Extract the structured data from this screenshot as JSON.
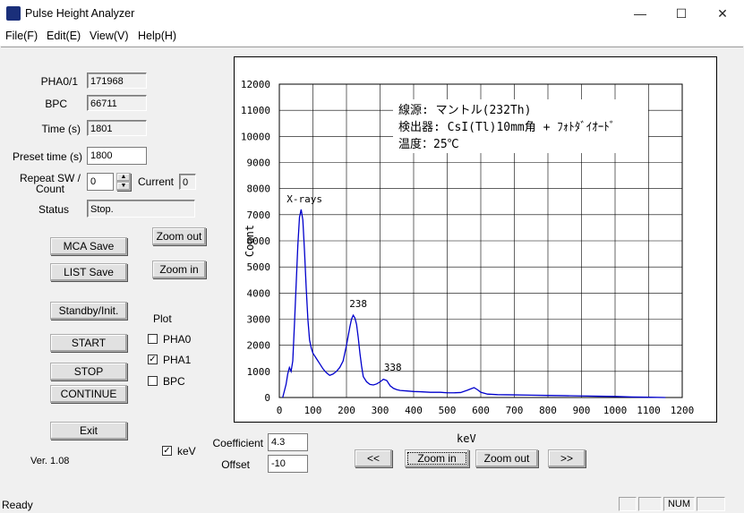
{
  "window": {
    "title": "Pulse Height Analyzer",
    "minimize": "—",
    "maximize": "☐",
    "close": "✕"
  },
  "menu": [
    "File(F)",
    "Edit(E)",
    "View(V)",
    "Help(H)"
  ],
  "fields": {
    "pha01_label": "PHA0/1",
    "pha01_value": "171968",
    "bpc_label": "BPC",
    "bpc_value": "66711",
    "time_label": "Time (s)",
    "time_value": "1801",
    "preset_label": "Preset time (s)",
    "preset_value": "1800",
    "repeat_label": "Repeat SW / Count",
    "repeat_value": "0",
    "current_label": "Current",
    "current_value": "0",
    "status_label": "Status",
    "status_value": "Stop."
  },
  "buttons": {
    "mca_save": "MCA Save",
    "list_save": "LIST Save",
    "standby": "Standby/Init.",
    "start": "START",
    "stop": "STOP",
    "continue": "CONTINUE",
    "exit": "Exit",
    "zoom_out_top": "Zoom out",
    "zoom_in_top": "Zoom in",
    "prev": "<<",
    "zoom_in_bottom": "Zoom in",
    "zoom_out_bottom": "Zoom out",
    "next": ">>"
  },
  "plot_options": {
    "heading": "Plot",
    "pha0": "PHA0",
    "pha0_checked": false,
    "pha1": "PHA1",
    "pha1_checked": true,
    "bpc": "BPC",
    "bpc_checked": false
  },
  "kev": {
    "label": "keV",
    "checked": true,
    "check_mark": "✓"
  },
  "calibration": {
    "coefficient_label": "Coefficient",
    "coefficient_value": "4.3",
    "offset_label": "Offset",
    "offset_value": "-10"
  },
  "version": "Ver. 1.08",
  "statusbar": {
    "text": "Ready",
    "num": "NUM"
  },
  "chart_data": {
    "type": "line",
    "xlabel": "keV",
    "ylabel": "Count",
    "xlim": [
      0,
      1200
    ],
    "ylim": [
      0,
      12000
    ],
    "xticks": [
      0,
      100,
      200,
      300,
      400,
      500,
      600,
      700,
      800,
      900,
      1000,
      1100,
      1200
    ],
    "yticks": [
      0,
      1000,
      2000,
      3000,
      4000,
      5000,
      6000,
      7000,
      8000,
      9000,
      10000,
      11000,
      12000
    ],
    "grid": true,
    "series_color": "#0000cc",
    "annotation_lines": [
      "線源: マントル(232Th)",
      "検出器: CsI(Tl)10mm角 + ﾌｫﾄﾀﾞｲｵｰﾄﾞ",
      "温度：25℃"
    ],
    "peak_labels": [
      {
        "text": "X-rays",
        "x": 75,
        "y": 7300
      },
      {
        "text": "238",
        "x": 235,
        "y": 3300
      },
      {
        "text": "338",
        "x": 338,
        "y": 850
      }
    ],
    "x": [
      10,
      20,
      25,
      30,
      35,
      40,
      45,
      50,
      55,
      60,
      65,
      70,
      75,
      80,
      85,
      90,
      95,
      100,
      110,
      120,
      130,
      140,
      150,
      160,
      170,
      180,
      190,
      200,
      210,
      215,
      220,
      225,
      230,
      235,
      240,
      245,
      250,
      260,
      270,
      280,
      290,
      300,
      310,
      320,
      330,
      340,
      350,
      360,
      380,
      400,
      420,
      450,
      480,
      500,
      520,
      540,
      560,
      570,
      580,
      590,
      600,
      620,
      650,
      700,
      750,
      800,
      850,
      900,
      950,
      1000,
      1050,
      1100,
      1150
    ],
    "y": [
      0,
      500,
      900,
      1150,
      1000,
      1400,
      2800,
      4300,
      5800,
      6900,
      7200,
      6800,
      5600,
      4200,
      3000,
      2200,
      1900,
      1700,
      1500,
      1300,
      1100,
      950,
      850,
      900,
      1000,
      1150,
      1400,
      2000,
      2700,
      3000,
      3150,
      3050,
      2800,
      2300,
      1700,
      1200,
      800,
      600,
      500,
      480,
      520,
      600,
      700,
      650,
      450,
      350,
      300,
      270,
      250,
      230,
      220,
      200,
      200,
      180,
      180,
      190,
      280,
      330,
      380,
      300,
      200,
      130,
      110,
      100,
      90,
      80,
      70,
      60,
      50,
      40,
      20,
      10,
      0
    ]
  }
}
